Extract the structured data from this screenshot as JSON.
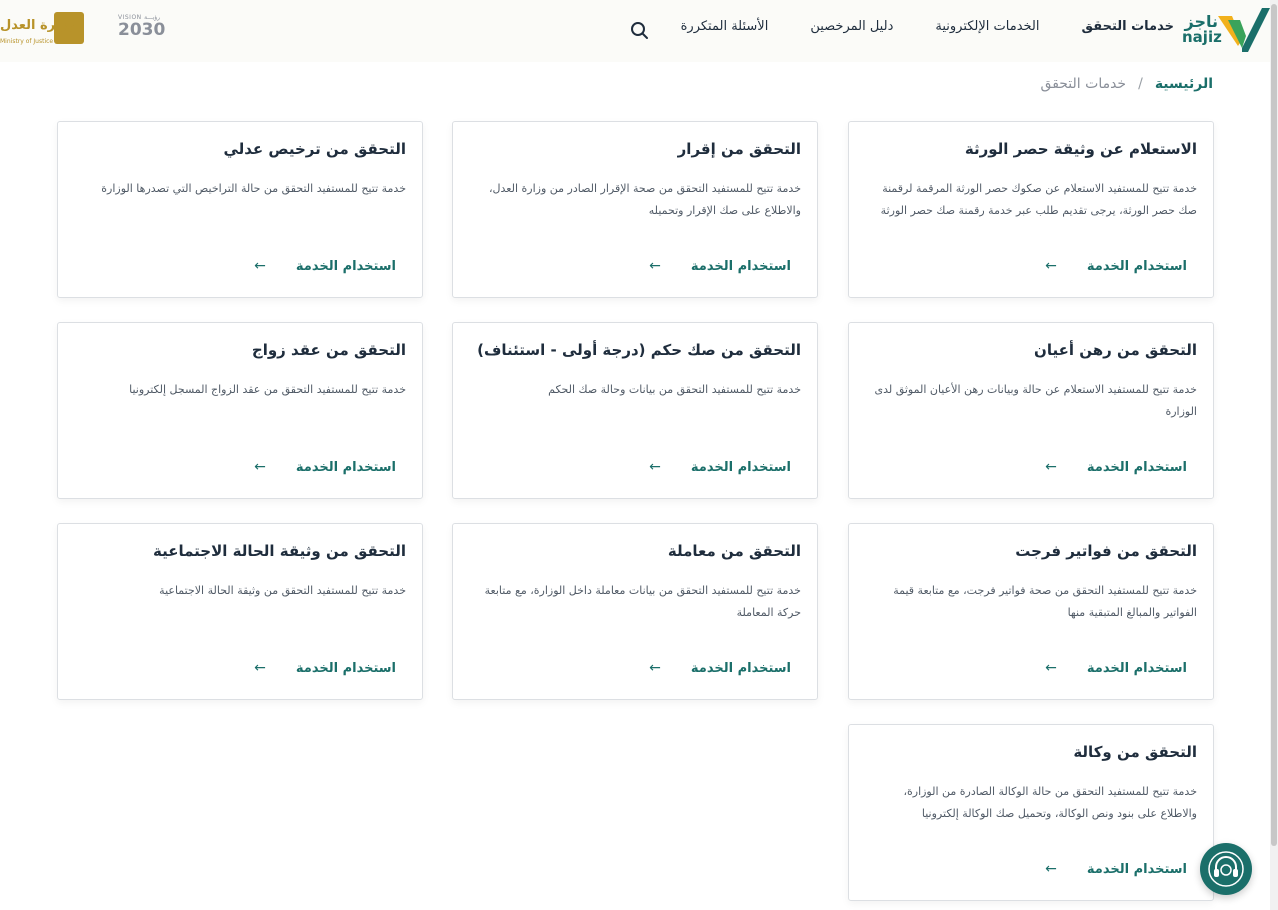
{
  "header": {
    "logo_ar": "ناجز",
    "logo_en": "najiz",
    "nav": [
      "خدمات التحقق",
      "الخدمات الإلكترونية",
      "دليل المرخصين",
      "الأسئلة المتكررة"
    ],
    "vision_small": "VISION رؤيـــة",
    "vision_big": "2030",
    "moj_ar": "وزارة العدل",
    "moj_en": "Ministry of Justice"
  },
  "breadcrumb": {
    "home": "الرئيسية",
    "sep": "/",
    "current": "خدمات التحقق"
  },
  "action_label": "استخدام الخدمة",
  "cards": [
    {
      "title": "الاستعلام عن وثيقة حصر الورثة",
      "desc": "خدمة تتيح للمستفيد الاستعلام عن صكوك حصر الورثة المرقمة لرقمنة صك حصر الورثة، يرجى تقديم طلب عبر خدمة رقمنة صك حصر الورثة"
    },
    {
      "title": "التحقق من إقرار",
      "desc": "خدمة تتيح للمستفيد التحقق من صحة الإقرار الصادر من وزارة العدل، والاطلاع على صك الإقرار وتحميله"
    },
    {
      "title": "التحقق من ترخيص عدلي",
      "desc": "خدمة تتيح للمستفيد التحقق من حالة التراخيص التي تصدرها الوزارة"
    },
    {
      "title": "التحقق من رهن أعيان",
      "desc": "خدمة تتيح للمستفيد الاستعلام عن حالة وبيانات رهن الأعيان الموثق لدى الوزارة"
    },
    {
      "title": "التحقق من صك حكم (درجة أولى - استئناف)",
      "desc": "خدمة تتيح للمستفيد التحقق من بيانات وحالة صك الحكم"
    },
    {
      "title": "التحقق من عقد زواج",
      "desc": "خدمة تتيح للمستفيد التحقق من عقد الزواج المسجل إلكترونيا"
    },
    {
      "title": "التحقق من فواتير فرجت",
      "desc": "خدمة تتيح للمستفيد التحقق من صحة فواتير فرجت، مع متابعة قيمة الفواتير والمبالغ المتبقية منها"
    },
    {
      "title": "التحقق من معاملة",
      "desc": "خدمة تتيح للمستفيد التحقق من بيانات معاملة داخل الوزارة، مع متابعة حركة المعاملة"
    },
    {
      "title": "التحقق من وثيقة الحالة الاجتماعية",
      "desc": "خدمة تتيح للمستفيد التحقق من وثيقة الحالة الاجتماعية"
    },
    {
      "title": "التحقق من وكالة",
      "desc": "خدمة تتيح للمستفيد التحقق من حالة الوكالة الصادرة من الوزارة، والاطلاع على بنود ونص الوكالة، وتحميل صك الوكالة إلكترونيا"
    }
  ],
  "colors": {
    "accent": "#1b6f6a",
    "brand_green": "#3aa35b",
    "brand_yellow": "#f2b11c"
  }
}
